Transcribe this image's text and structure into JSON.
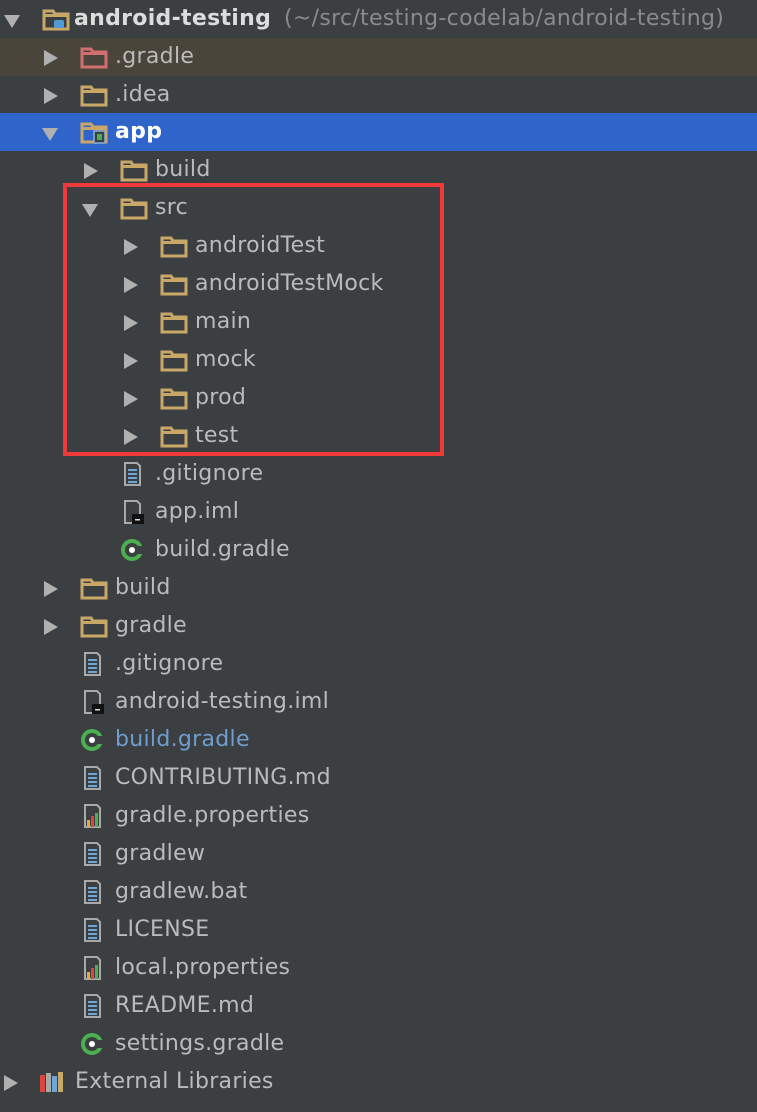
{
  "colors": {
    "background": "#3c3f41",
    "selected_row": "#2f65ca",
    "excluded_row": "#4a453b",
    "folder": "#c9a867",
    "excluded_folder": "#d16e6e",
    "gradle_green": "#4caf50",
    "doc_blue": "#6ea6d6",
    "highlight_box": "#f03a3a",
    "modified_file_text": "#6f9dcf"
  },
  "tree": {
    "root": {
      "label": "android-testing",
      "path": "(~/src/testing-codelab/android-testing)",
      "icon": "project-folder-icon"
    },
    "items": [
      {
        "label": ".gradle",
        "icon": "excluded-folder-icon"
      },
      {
        "label": ".idea",
        "icon": "folder-icon"
      },
      {
        "label": "app",
        "icon": "module-folder-icon"
      },
      {
        "label": "build",
        "icon": "folder-icon"
      },
      {
        "label": "src",
        "icon": "folder-icon"
      },
      {
        "label": "androidTest",
        "icon": "folder-icon"
      },
      {
        "label": "androidTestMock",
        "icon": "folder-icon"
      },
      {
        "label": "main",
        "icon": "folder-icon"
      },
      {
        "label": "mock",
        "icon": "folder-icon"
      },
      {
        "label": "prod",
        "icon": "folder-icon"
      },
      {
        "label": "test",
        "icon": "folder-icon"
      },
      {
        "label": ".gitignore",
        "icon": "text-file-icon"
      },
      {
        "label": "app.iml",
        "icon": "iml-file-icon"
      },
      {
        "label": "build.gradle",
        "icon": "gradle-icon"
      },
      {
        "label": "build",
        "icon": "folder-icon"
      },
      {
        "label": "gradle",
        "icon": "folder-icon"
      },
      {
        "label": ".gitignore",
        "icon": "text-file-icon"
      },
      {
        "label": "android-testing.iml",
        "icon": "iml-file-icon"
      },
      {
        "label": "build.gradle",
        "icon": "gradle-icon"
      },
      {
        "label": "CONTRIBUTING.md",
        "icon": "text-file-icon"
      },
      {
        "label": "gradle.properties",
        "icon": "properties-file-icon"
      },
      {
        "label": "gradlew",
        "icon": "text-file-icon"
      },
      {
        "label": "gradlew.bat",
        "icon": "text-file-icon"
      },
      {
        "label": "LICENSE",
        "icon": "text-file-icon"
      },
      {
        "label": "local.properties",
        "icon": "properties-file-icon"
      },
      {
        "label": "README.md",
        "icon": "text-file-icon"
      },
      {
        "label": "settings.gradle",
        "icon": "gradle-icon"
      },
      {
        "label": "External Libraries",
        "icon": "libraries-icon"
      }
    ]
  }
}
